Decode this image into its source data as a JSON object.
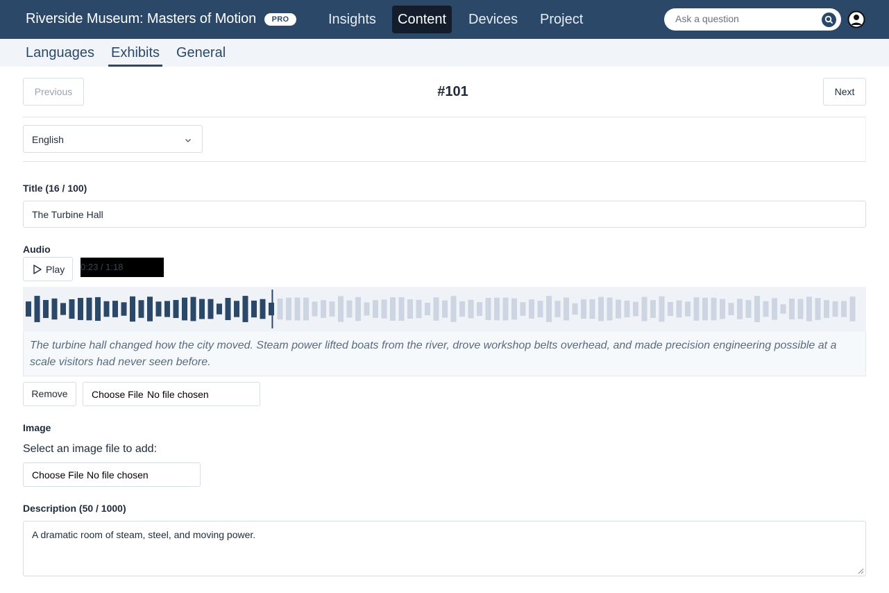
{
  "header": {
    "app_title": "Riverside Museum: Masters of Motion",
    "badge": "PRO",
    "nav": [
      {
        "label": "Insights",
        "active": false
      },
      {
        "label": "Content",
        "active": true
      },
      {
        "label": "Devices",
        "active": false
      },
      {
        "label": "Project",
        "active": false
      }
    ],
    "search_placeholder": "Ask a question",
    "search_icon": "search-icon",
    "account_icon": "user-circle-icon"
  },
  "subnav": {
    "tabs": [
      {
        "label": "Languages",
        "active": false
      },
      {
        "label": "Exhibits",
        "active": true
      },
      {
        "label": "General",
        "active": false
      }
    ]
  },
  "pager": {
    "previous_label": "Previous",
    "next_label": "Next",
    "record_id": "#101"
  },
  "language": {
    "selected": "English"
  },
  "title_field": {
    "label": "Title (16 / 100)",
    "value": "The Turbine Hall"
  },
  "audio": {
    "label": "Audio",
    "play_label": "Play",
    "time_display": "0:23 / 1:18",
    "progress": 0.295,
    "transcript": "The turbine hall changed how the city moved. Steam power lifted boats from the river, drove workshop belts overhead, and made precision engineering possible at a scale visitors had never seen before.",
    "remove_label": "Remove",
    "file_choose_label": "Choose File",
    "file_none_label": "No file chosen"
  },
  "image": {
    "label": "Image",
    "prompt": "Select an image file to add:",
    "file_choose_label": "Choose File",
    "file_none_label": "No file chosen"
  },
  "description": {
    "label": "Description (50 / 1000)",
    "value": "A dramatic room of steam, steel, and moving power."
  },
  "colors": {
    "nav_bg": "#2b4868",
    "nav_active_bg": "#141d2b",
    "wave_played": "#2b4868",
    "wave_unplayed": "#ccd5e1"
  }
}
